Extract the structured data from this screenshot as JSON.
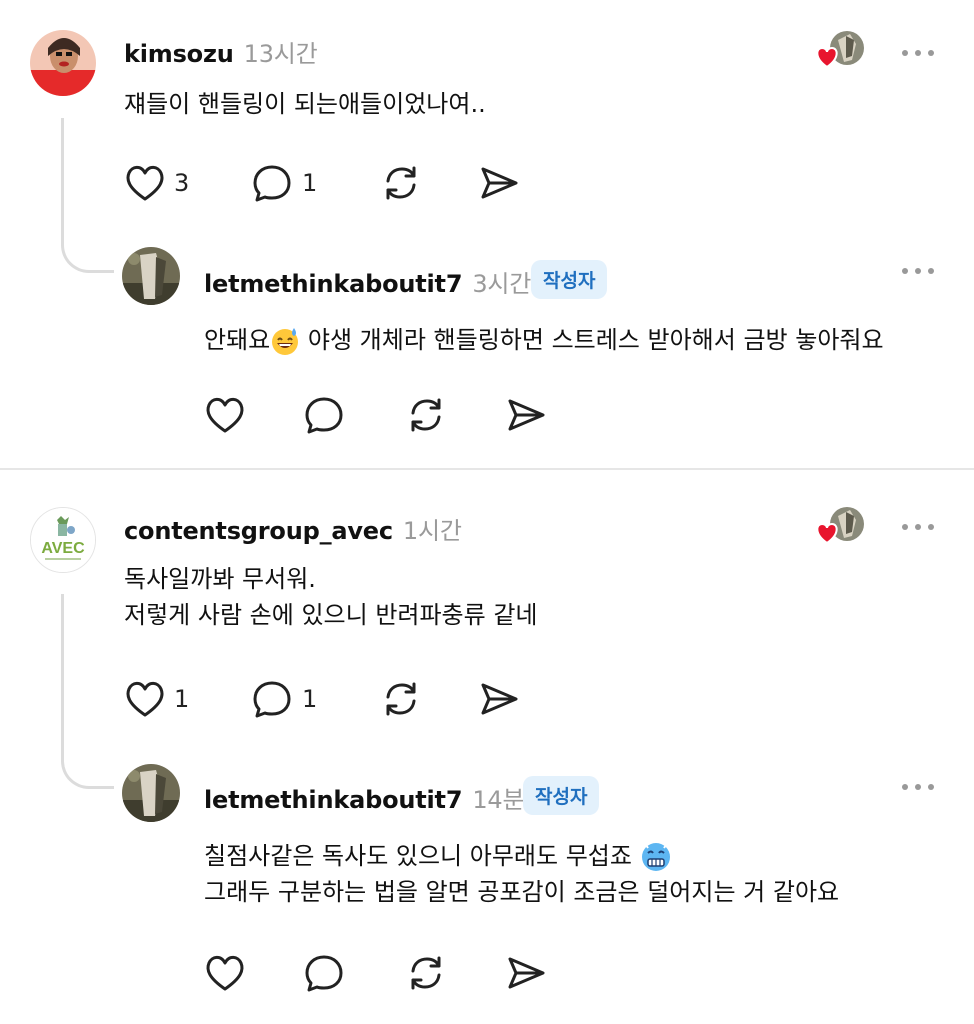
{
  "threads": [
    {
      "comment": {
        "username": "kimsozu",
        "time": "13시간",
        "lines": [
          "쟤들이 핸들링이 되는애들이었나여.."
        ],
        "likes": "3",
        "replies": "1"
      },
      "reply": {
        "username": "letmethinkaboutit7",
        "time": "3시간",
        "badge": "작성자",
        "line1_before": "안돼요",
        "line1_after": " 야생 개체라 핸들링하면 스트레스 받아해서 금방 놓아줘요"
      }
    },
    {
      "comment": {
        "username": "contentsgroup_avec",
        "time": "1시간",
        "lines": [
          "독사일까봐 무서워.",
          "저렇게 사람 손에 있으니 반려파충류 같네"
        ],
        "likes": "1",
        "replies": "1",
        "avatar_text": "AVEC"
      },
      "reply": {
        "username": "letmethinkaboutit7",
        "time": "14분",
        "badge": "작성자",
        "line1_before": "칠점사같은 독사도 있으니 아무래도 무섭죠",
        "line2": "그래두 구분하는 법을 알면 공포감이 조금은 덜어지는 거 같아요"
      }
    }
  ],
  "icons": {
    "like": "heart-outline-icon",
    "reply": "speech-bubble-icon",
    "repost": "repost-arrows-icon",
    "share": "paper-plane-icon",
    "more": "more-dots-icon",
    "author_liked": "author-liked-heart-icon"
  },
  "colors": {
    "badge_bg": "#e3f1fc",
    "badge_text": "#1f6fbf",
    "time": "#9a9a9a",
    "liked_heart": "#e8152e"
  }
}
